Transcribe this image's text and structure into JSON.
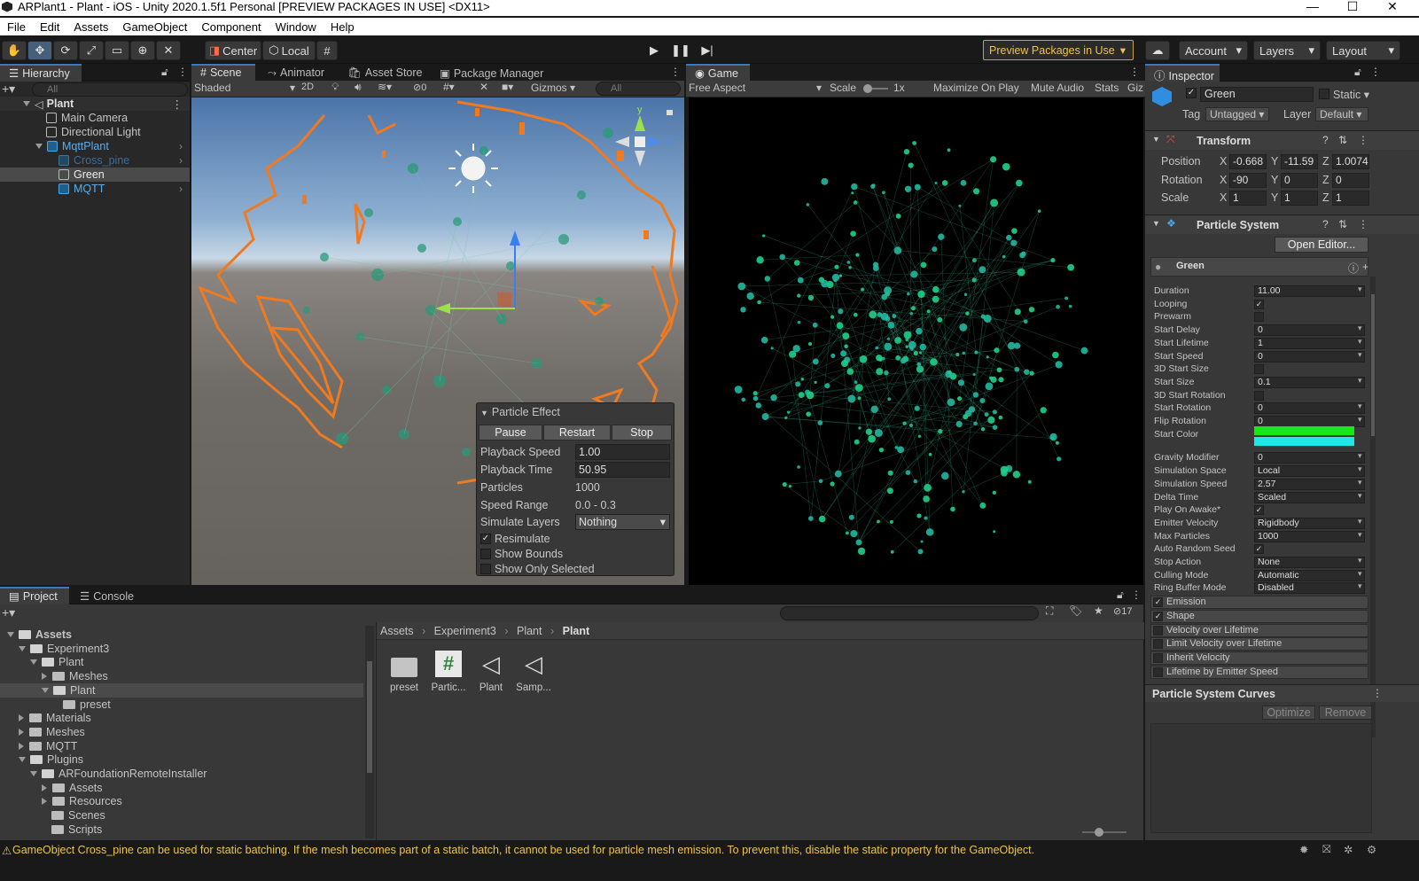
{
  "window": {
    "title": "ARPlant1 - Plant - iOS - Unity 2020.1.5f1 Personal [PREVIEW PACKAGES IN USE] <DX11>"
  },
  "menu": [
    "File",
    "Edit",
    "Assets",
    "GameObject",
    "Component",
    "Window",
    "Help"
  ],
  "toolbar": {
    "pivot": "Center",
    "space": "Local",
    "preview_packages": "Preview Packages in Use",
    "account": "Account",
    "layers": "Layers",
    "layout": "Layout"
  },
  "hierarchy": {
    "tab": "Hierarchy",
    "search_placeholder": "All",
    "items": [
      {
        "label": "Plant",
        "depth": 0
      },
      {
        "label": "Main Camera",
        "depth": 1
      },
      {
        "label": "Directional Light",
        "depth": 1
      },
      {
        "label": "MqttPlant",
        "depth": 1
      },
      {
        "label": "Cross_pine",
        "depth": 2
      },
      {
        "label": "Green",
        "depth": 2
      },
      {
        "label": "MQTT",
        "depth": 2
      }
    ]
  },
  "scene": {
    "tabs": [
      "Scene",
      "Animator",
      "Asset Store",
      "Package Manager"
    ],
    "shading": "Shaded",
    "mode2d": "2D",
    "hidden_count": "0",
    "gizmos": "Gizmos",
    "search_placeholder": "All",
    "particle_effect": {
      "title": "Particle Effect",
      "buttons": [
        "Pause",
        "Restart",
        "Stop"
      ],
      "playback_speed_label": "Playback Speed",
      "playback_speed": "1.00",
      "playback_time_label": "Playback Time",
      "playback_time": "50.95",
      "particles_label": "Particles",
      "particles": "1000",
      "speed_range_label": "Speed Range",
      "speed_range": "0.0 - 0.3",
      "simulate_layers_label": "Simulate Layers",
      "simulate_layers": "Nothing",
      "resimulate": "Resimulate",
      "show_bounds": "Show Bounds",
      "show_only_selected": "Show Only Selected"
    }
  },
  "game": {
    "tab": "Game",
    "aspect": "Free Aspect",
    "scale_label": "Scale",
    "scale": "1x",
    "maximize": "Maximize On Play",
    "mute": "Mute Audio",
    "stats": "Stats",
    "gizmos": "Giz"
  },
  "inspector": {
    "tab": "Inspector",
    "object_name": "Green",
    "static": "Static",
    "tag_label": "Tag",
    "tag": "Untagged",
    "layer_label": "Layer",
    "layer": "Default",
    "transform": {
      "title": "Transform",
      "position_label": "Position",
      "position": [
        "-0.668",
        "-11.59",
        "1.0074"
      ],
      "rotation_label": "Rotation",
      "rotation": [
        "-90",
        "0",
        "0"
      ],
      "scale_label": "Scale",
      "scale": [
        "1",
        "1",
        "1"
      ]
    },
    "particle_system": {
      "title": "Particle System",
      "open_editor": "Open Editor...",
      "sub_name": "Green",
      "fields": [
        {
          "label": "Duration",
          "value": "11.00"
        },
        {
          "label": "Looping",
          "check": true
        },
        {
          "label": "Prewarm",
          "check": false
        },
        {
          "label": "Start Delay",
          "value": "0"
        },
        {
          "label": "Start Lifetime",
          "value": "1"
        },
        {
          "label": "Start Speed",
          "value": "0"
        },
        {
          "label": "3D Start Size",
          "check": false
        },
        {
          "label": "Start Size",
          "value": "0.1"
        },
        {
          "label": "3D Start Rotation",
          "check": false
        },
        {
          "label": "Start Rotation",
          "value": "0"
        },
        {
          "label": "Flip Rotation",
          "value": "0"
        },
        {
          "label": "Start Color",
          "value": ""
        },
        {
          "label": "Gravity Modifier",
          "value": "0"
        },
        {
          "label": "Simulation Space",
          "value": "Local"
        },
        {
          "label": "Simulation Speed",
          "value": "2.57"
        },
        {
          "label": "Delta Time",
          "value": "Scaled"
        },
        {
          "label": "Play On Awake*",
          "check": true
        },
        {
          "label": "Emitter Velocity",
          "value": "Rigidbody"
        },
        {
          "label": "Max Particles",
          "value": "1000"
        },
        {
          "label": "Auto Random Seed",
          "check": true
        },
        {
          "label": "Stop Action",
          "value": "None"
        },
        {
          "label": "Culling Mode",
          "value": "Automatic"
        },
        {
          "label": "Ring Buffer Mode",
          "value": "Disabled"
        }
      ],
      "modules": [
        {
          "label": "Emission",
          "on": true
        },
        {
          "label": "Shape",
          "on": true
        },
        {
          "label": "Velocity over Lifetime",
          "on": false
        },
        {
          "label": "Limit Velocity over Lifetime",
          "on": false
        },
        {
          "label": "Inherit Velocity",
          "on": false
        },
        {
          "label": "Lifetime by Emitter Speed",
          "on": false
        }
      ]
    },
    "curves": {
      "title": "Particle System Curves",
      "optimize": "Optimize",
      "remove": "Remove"
    },
    "colors": {
      "start_color_a": "#16e81a",
      "start_color_b": "#1ee8e8"
    }
  },
  "project": {
    "tabs": [
      "Project",
      "Console"
    ],
    "hidden_count": "17",
    "tree": [
      {
        "label": "Assets",
        "depth": 0
      },
      {
        "label": "Experiment3",
        "depth": 1
      },
      {
        "label": "Plant",
        "depth": 2
      },
      {
        "label": "Meshes",
        "depth": 3
      },
      {
        "label": "Plant",
        "depth": 3
      },
      {
        "label": "preset",
        "depth": 4
      },
      {
        "label": "Materials",
        "depth": 1
      },
      {
        "label": "Meshes",
        "depth": 1
      },
      {
        "label": "MQTT",
        "depth": 1
      },
      {
        "label": "Plugins",
        "depth": 1
      },
      {
        "label": "ARFoundationRemoteInstaller",
        "depth": 2
      },
      {
        "label": "Assets",
        "depth": 3
      },
      {
        "label": "Resources",
        "depth": 3
      },
      {
        "label": "Scenes",
        "depth": 3
      },
      {
        "label": "Scripts",
        "depth": 3
      }
    ],
    "breadcrumb": [
      "Assets",
      "Experiment3",
      "Plant",
      "Plant"
    ],
    "assets": [
      {
        "label": "preset",
        "icon": "folder-icon"
      },
      {
        "label": "Partic...",
        "icon": "script-icon"
      },
      {
        "label": "Plant",
        "icon": "unity-scene-icon"
      },
      {
        "label": "Samp...",
        "icon": "unity-scene-icon"
      }
    ]
  },
  "status": {
    "message": "GameObject Cross_pine can be used for static batching. If the mesh becomes part of a static batch, it cannot be used for particle mesh emission. To prevent this, disable the static property for the GameObject."
  }
}
